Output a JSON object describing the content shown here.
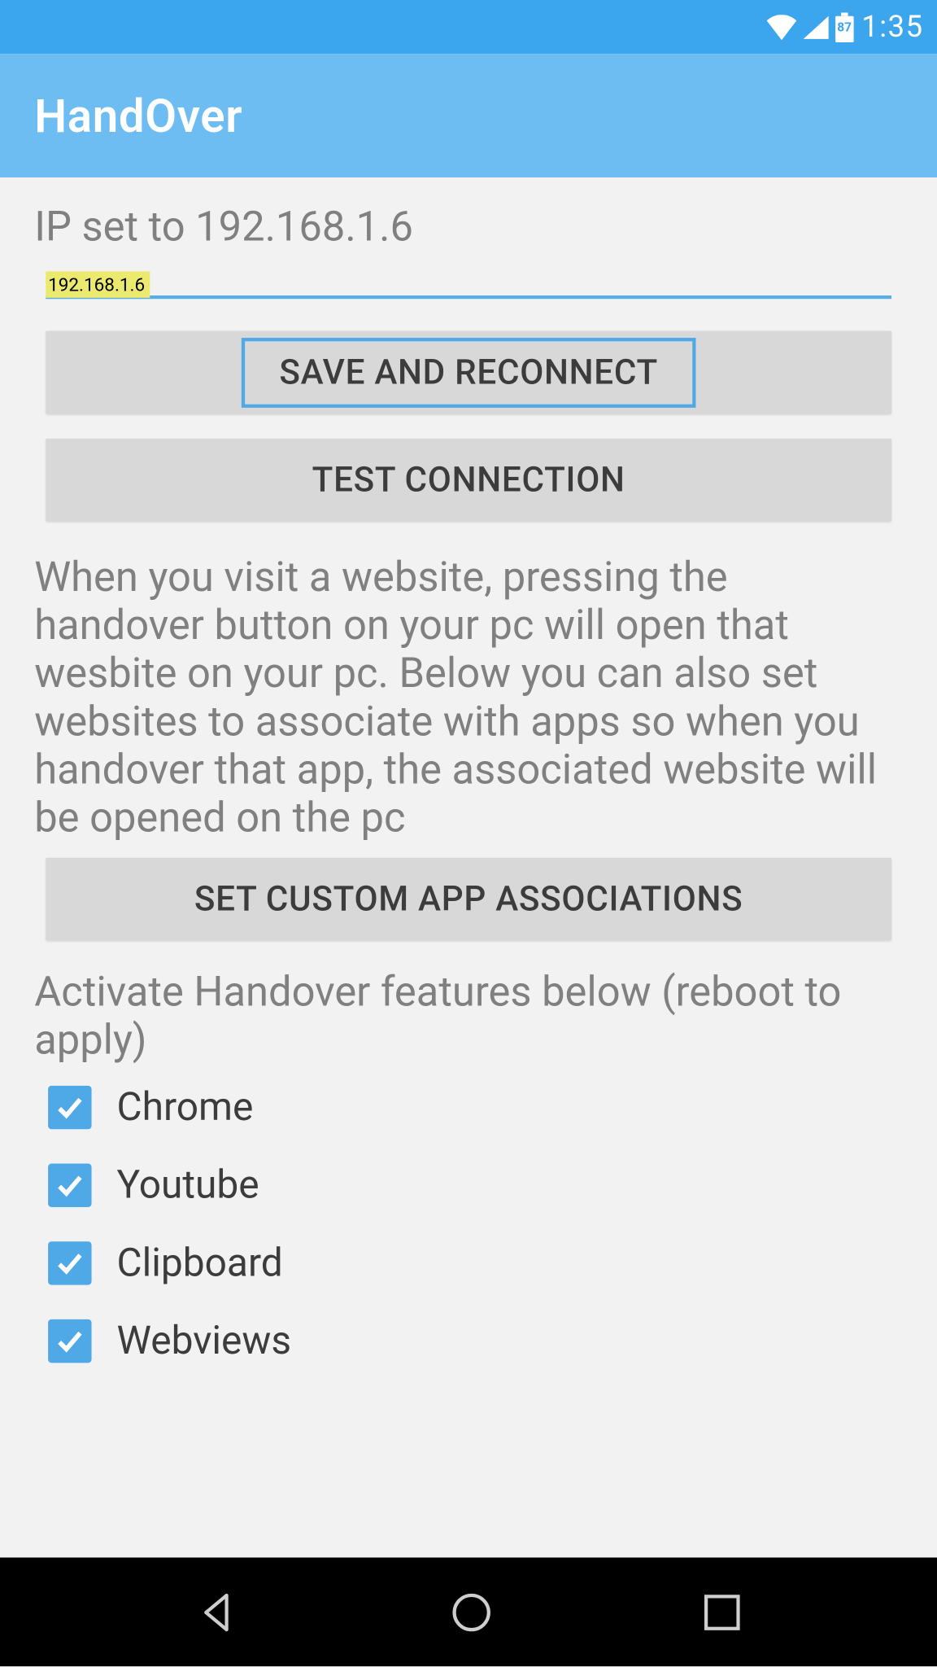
{
  "status_bar": {
    "battery_level": "87",
    "time": "1:35"
  },
  "app_bar": {
    "title": "HandOver"
  },
  "main": {
    "ip_label": "IP set to 192.168.1.6",
    "ip_value": "192.168.1.6",
    "save_button": "SAVE AND RECONNECT",
    "test_button": "TEST CONNECTION",
    "description": "When you visit a website, pressing the handover button on your pc will open that wesbite on your pc. Below you can also set websites to associate with apps so when you handover that app, the associated website will be opened on the pc",
    "associations_button": "SET CUSTOM APP ASSOCIATIONS",
    "activate_label": "Activate Handover features below (reboot to apply)",
    "features": [
      {
        "label": "Chrome",
        "checked": true
      },
      {
        "label": "Youtube",
        "checked": true
      },
      {
        "label": "Clipboard",
        "checked": true
      },
      {
        "label": "Webviews",
        "checked": true
      }
    ]
  }
}
